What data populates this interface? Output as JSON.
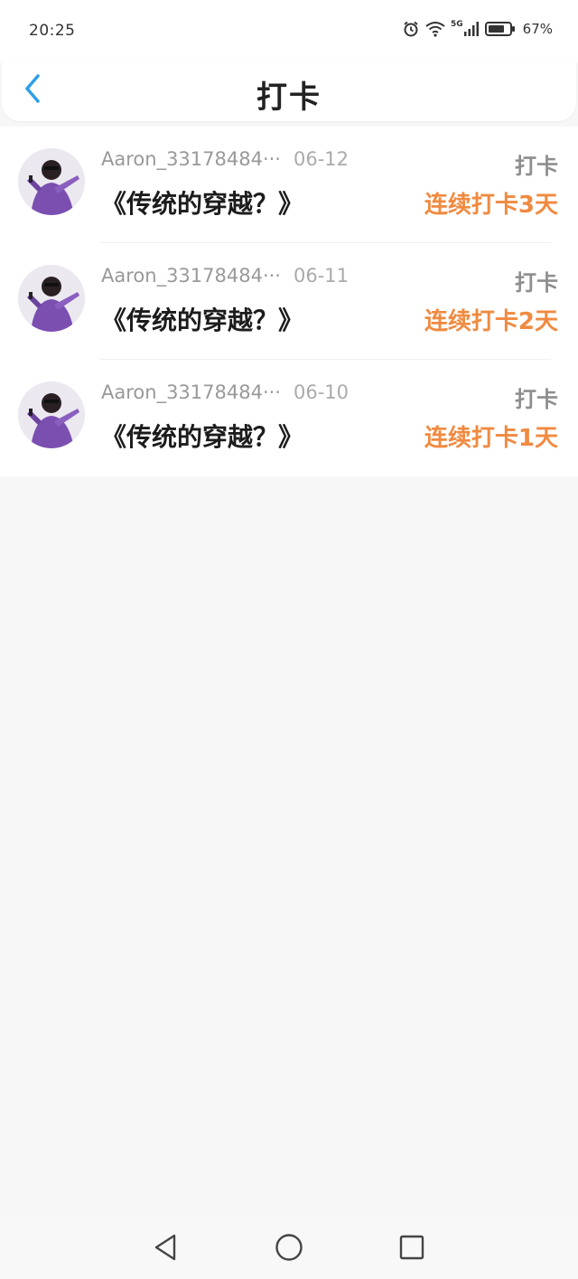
{
  "status_bar": {
    "time": "20:25",
    "network": "5G",
    "battery": "67%",
    "icons": [
      "alarm-icon",
      "wifi-icon",
      "signal-icon",
      "battery-icon"
    ]
  },
  "header": {
    "title": "打卡",
    "back_icon": "chevron-left-icon"
  },
  "items": [
    {
      "user": "Aaron_33178484···",
      "date": "06-12",
      "book": "《传统的穿越？》",
      "type": "打卡",
      "streak": "连续打卡3天"
    },
    {
      "user": "Aaron_33178484···",
      "date": "06-11",
      "book": "《传统的穿越？》",
      "type": "打卡",
      "streak": "连续打卡2天"
    },
    {
      "user": "Aaron_33178484···",
      "date": "06-10",
      "book": "《传统的穿越？》",
      "type": "打卡",
      "streak": "连续打卡1天"
    }
  ],
  "nav_bar": {
    "icons": [
      "back-triangle-icon",
      "home-circle-icon",
      "recents-square-icon"
    ]
  },
  "colors": {
    "accent_blue": "#2f9ee8",
    "streak_orange": "#f08a40",
    "background": "#f8f7f8"
  }
}
